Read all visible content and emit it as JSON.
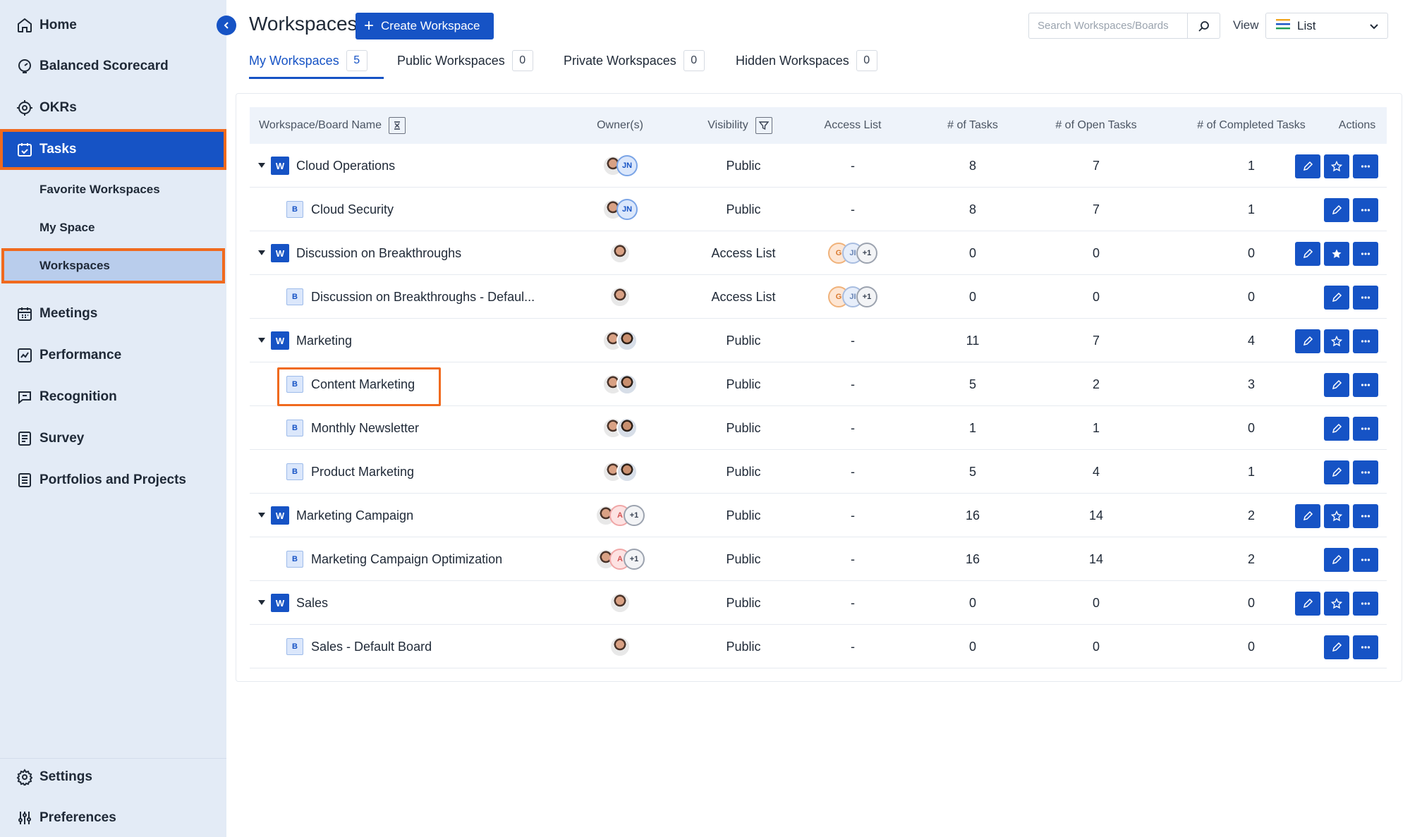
{
  "sidebar": {
    "items": [
      {
        "label": "Home",
        "icon": "home-icon"
      },
      {
        "label": "Balanced Scorecard",
        "icon": "scorecard-icon"
      },
      {
        "label": "OKRs",
        "icon": "target-icon"
      },
      {
        "label": "Tasks",
        "icon": "calendar-check-icon"
      },
      {
        "label": "Meetings",
        "icon": "calendar-icon"
      },
      {
        "label": "Performance",
        "icon": "chart-icon"
      },
      {
        "label": "Recognition",
        "icon": "chat-icon"
      },
      {
        "label": "Survey",
        "icon": "list-icon"
      },
      {
        "label": "Portfolios and Projects",
        "icon": "document-icon"
      }
    ],
    "tasks_sub": [
      {
        "label": "Favorite Workspaces"
      },
      {
        "label": "My Space"
      },
      {
        "label": "Workspaces"
      }
    ],
    "bottom": [
      {
        "label": "Settings",
        "icon": "gear-icon"
      },
      {
        "label": "Preferences",
        "icon": "sliders-icon"
      }
    ]
  },
  "header": {
    "title": "Workspaces",
    "create_label": "Create Workspace",
    "search_placeholder": "Search Workspaces/Boards",
    "view_label": "View",
    "view_value": "List"
  },
  "tabs": [
    {
      "label": "My Workspaces",
      "count": "5"
    },
    {
      "label": "Public Workspaces",
      "count": "0"
    },
    {
      "label": "Private Workspaces",
      "count": "0"
    },
    {
      "label": "Hidden Workspaces",
      "count": "0"
    }
  ],
  "table": {
    "columns": [
      "Workspace/Board Name",
      "Owner(s)",
      "Visibility",
      "Access List",
      "# of Tasks",
      "# of Open Tasks",
      "# of Completed Tasks",
      "Actions"
    ],
    "rows": [
      {
        "type": "W",
        "name": "Cloud Operations",
        "owners": [
          "photo",
          "JN"
        ],
        "visibility": "Public",
        "access": "-",
        "tasks": "8",
        "open": "7",
        "completed": "1",
        "starred": false
      },
      {
        "type": "B",
        "name": "Cloud Security",
        "owners": [
          "photo",
          "JN"
        ],
        "visibility": "Public",
        "access": "-",
        "tasks": "8",
        "open": "7",
        "completed": "1"
      },
      {
        "type": "W",
        "name": "Discussion on Breakthroughs",
        "owners": [
          "photo"
        ],
        "visibility": "Access List",
        "access_avatars": [
          "G",
          "JI",
          "+1"
        ],
        "access": "",
        "tasks": "0",
        "open": "0",
        "completed": "0",
        "starred": true
      },
      {
        "type": "B",
        "name": "Discussion on Breakthroughs - Defaul...",
        "owners": [
          "photo"
        ],
        "visibility": "Access List",
        "access_avatars": [
          "G",
          "JI",
          "+1"
        ],
        "access": "",
        "tasks": "0",
        "open": "0",
        "completed": "0"
      },
      {
        "type": "W",
        "name": "Marketing",
        "owners": [
          "photo",
          "photo2"
        ],
        "visibility": "Public",
        "access": "-",
        "tasks": "11",
        "open": "7",
        "completed": "4",
        "starred": false
      },
      {
        "type": "B",
        "name": "Content Marketing",
        "owners": [
          "photo",
          "photo2"
        ],
        "visibility": "Public",
        "access": "-",
        "tasks": "5",
        "open": "2",
        "completed": "3"
      },
      {
        "type": "B",
        "name": "Monthly Newsletter",
        "owners": [
          "photo",
          "photo2"
        ],
        "visibility": "Public",
        "access": "-",
        "tasks": "1",
        "open": "1",
        "completed": "0"
      },
      {
        "type": "B",
        "name": "Product Marketing",
        "owners": [
          "photo",
          "photo2"
        ],
        "visibility": "Public",
        "access": "-",
        "tasks": "5",
        "open": "4",
        "completed": "1"
      },
      {
        "type": "W",
        "name": "Marketing Campaign",
        "owners": [
          "photo",
          "A",
          "+1"
        ],
        "visibility": "Public",
        "access": "-",
        "tasks": "16",
        "open": "14",
        "completed": "2",
        "starred": false
      },
      {
        "type": "B",
        "name": "Marketing Campaign Optimization",
        "owners": [
          "photo",
          "A",
          "+1"
        ],
        "visibility": "Public",
        "access": "-",
        "tasks": "16",
        "open": "14",
        "completed": "2"
      },
      {
        "type": "W",
        "name": "Sales",
        "owners": [
          "photo"
        ],
        "visibility": "Public",
        "access": "-",
        "tasks": "0",
        "open": "0",
        "completed": "0",
        "starred": false
      },
      {
        "type": "B",
        "name": "Sales - Default Board",
        "owners": [
          "photo"
        ],
        "visibility": "Public",
        "access": "-",
        "tasks": "0",
        "open": "0",
        "completed": "0"
      }
    ]
  },
  "colors": {
    "primary": "#1653c5",
    "highlight": "#f06a1e",
    "sidebar_bg": "#e3ebf6"
  }
}
